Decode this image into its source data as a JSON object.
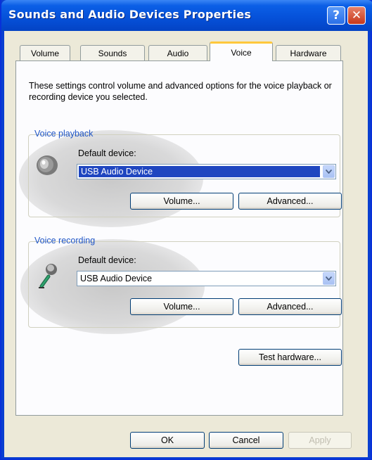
{
  "window": {
    "title": "Sounds and Audio Devices Properties"
  },
  "titlebar": {
    "help_glyph": "?",
    "close_glyph": "✕"
  },
  "tabs": [
    {
      "label": "Volume",
      "active": false
    },
    {
      "label": "Sounds",
      "active": false
    },
    {
      "label": "Audio",
      "active": false
    },
    {
      "label": "Voice",
      "active": true
    },
    {
      "label": "Hardware",
      "active": false
    }
  ],
  "description": "These settings control volume and advanced options for the voice playback or recording device you selected.",
  "playback": {
    "legend": "Voice playback",
    "label": "Default device:",
    "device": "USB Audio Device",
    "volume_label": "Volume...",
    "advanced_label": "Advanced..."
  },
  "recording": {
    "legend": "Voice recording",
    "label": "Default device:",
    "device": "USB Audio Device",
    "volume_label": "Volume...",
    "advanced_label": "Advanced..."
  },
  "test_hardware_label": "Test hardware...",
  "footer": {
    "ok_label": "OK",
    "cancel_label": "Cancel",
    "apply_label": "Apply"
  },
  "colors": {
    "accent": "#0a3fd0",
    "legend": "#1f55c6",
    "selection": "#1f46c0"
  }
}
